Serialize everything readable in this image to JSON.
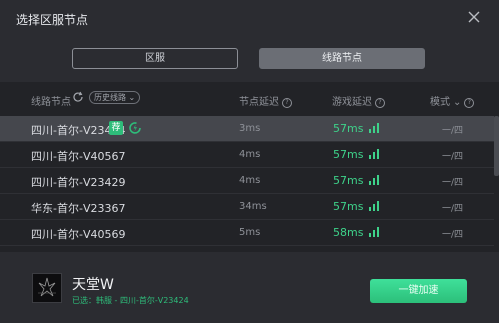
{
  "window": {
    "title": "选择区服节点"
  },
  "tabs": [
    {
      "label": "区服"
    },
    {
      "label": "线路节点"
    }
  ],
  "table": {
    "headers": {
      "route": "线路节点",
      "history": "历史线路",
      "node_delay": "节点延迟",
      "game_delay": "游戏延迟",
      "mode": "模式"
    },
    "rows": [
      {
        "name": "四川-首尔-V23424",
        "node": "3ms",
        "game": "57ms",
        "mode": "一/四",
        "badge": "荐"
      },
      {
        "name": "四川-首尔-V40567",
        "node": "4ms",
        "game": "57ms",
        "mode": "一/四"
      },
      {
        "name": "四川-首尔-V23429",
        "node": "4ms",
        "game": "57ms",
        "mode": "一/四"
      },
      {
        "name": "华东-首尔-V23367",
        "node": "34ms",
        "game": "57ms",
        "mode": "一/四"
      },
      {
        "name": "四川-首尔-V40569",
        "node": "5ms",
        "game": "58ms",
        "mode": "一/四"
      }
    ]
  },
  "footer": {
    "game_title": "天堂W",
    "selected": "已选：韩服 - 四川-首尔-V23424",
    "boost_button": "一键加速"
  },
  "colors": {
    "accent": "#2ebd7a",
    "latency_good": "#3ed28a"
  },
  "icons": [
    "close-icon",
    "refresh-icon",
    "chevron-down-icon",
    "help-icon",
    "signal-bars-icon",
    "boost-icon"
  ]
}
